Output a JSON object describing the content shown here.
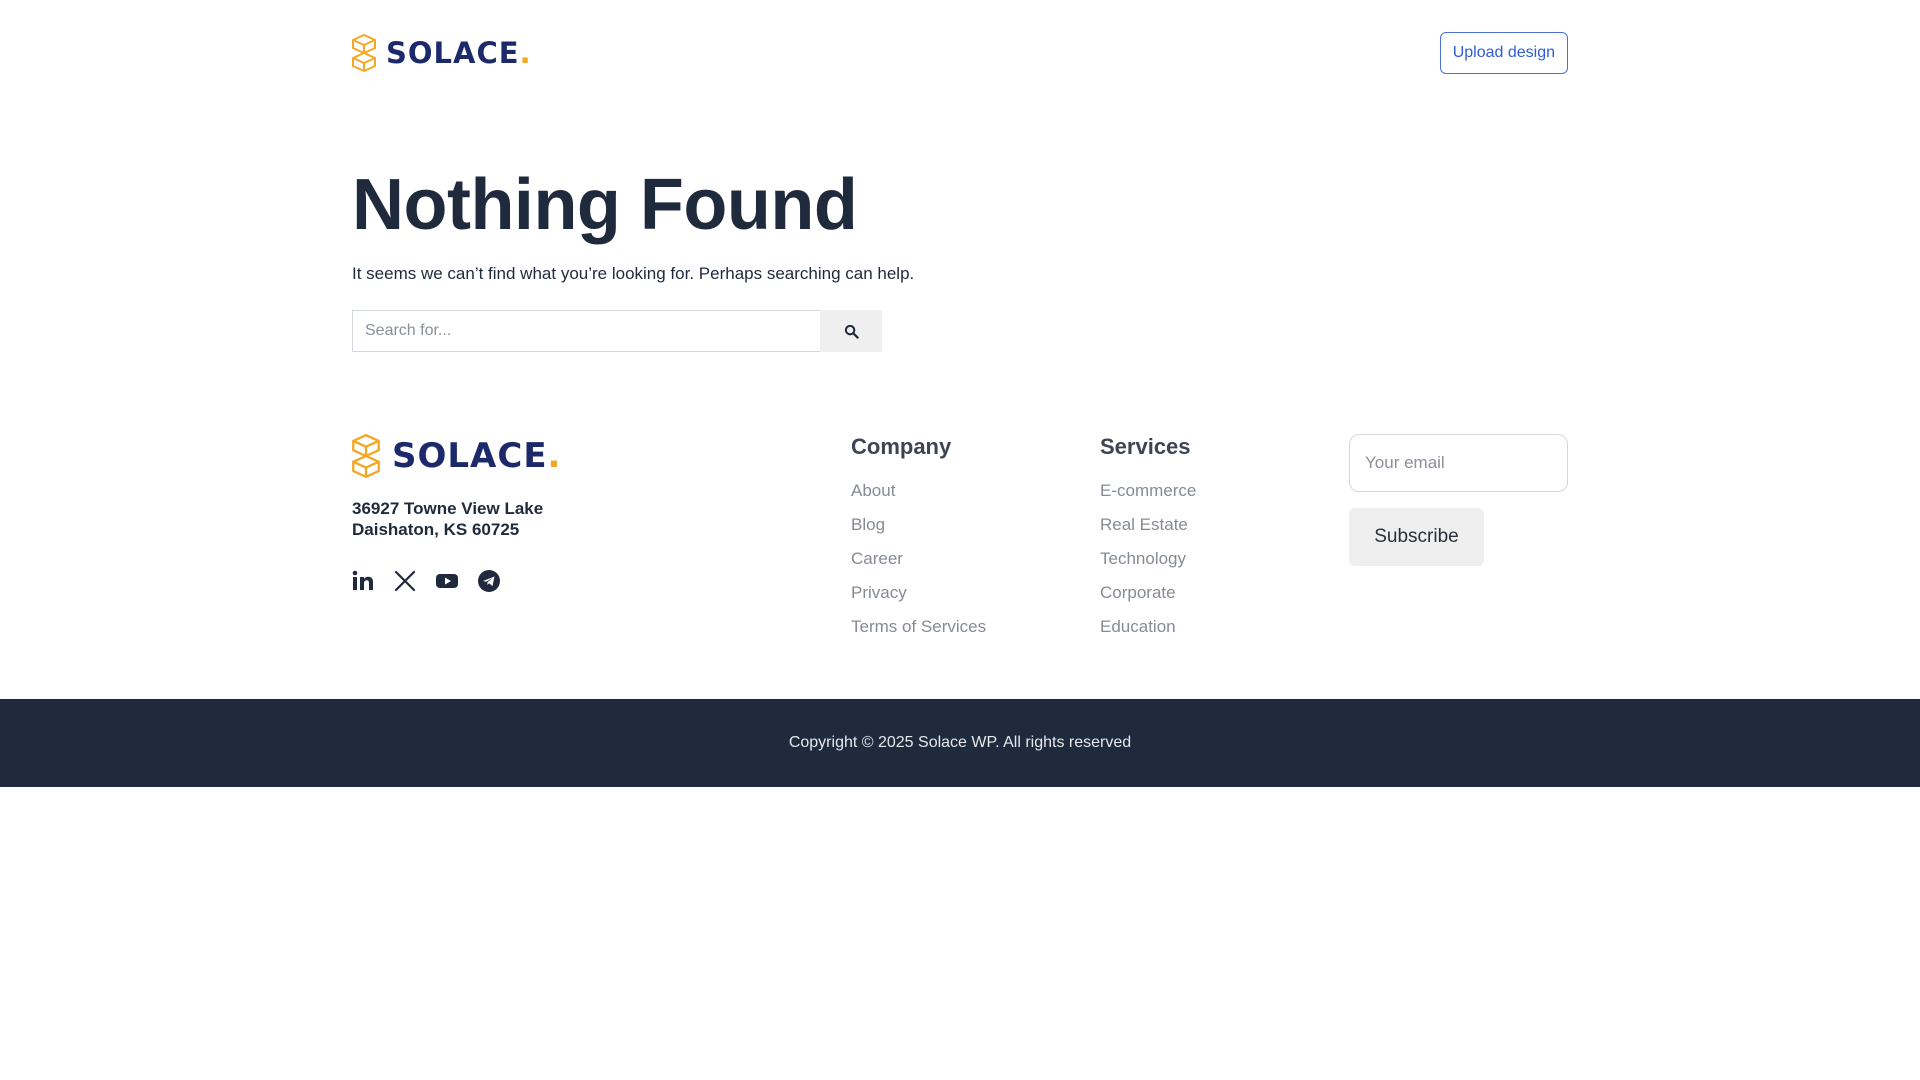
{
  "brand": {
    "name": "SOLACE",
    "dot": "."
  },
  "header": {
    "upload_label": "Upload design"
  },
  "main": {
    "title": "Nothing Found",
    "description": "It seems we can’t find what you’re looking for. Perhaps searching can help.",
    "search": {
      "placeholder": "Search for...",
      "button_icon": "search-icon"
    }
  },
  "footer": {
    "address_line1": "36927 Towne View Lake",
    "address_line2": "Daishaton, KS 60725",
    "social": [
      "linkedin-icon",
      "x-icon",
      "youtube-icon",
      "telegram-icon"
    ],
    "company": {
      "title": "Company",
      "items": [
        "About",
        "Blog",
        "Career",
        "Privacy",
        "Terms of Services"
      ]
    },
    "services": {
      "title": "Services",
      "items": [
        "E-commerce",
        "Real Estate",
        "Technology",
        "Corporate",
        "Education"
      ]
    },
    "newsletter": {
      "email_placeholder": "Your email",
      "subscribe_label": "Subscribe"
    }
  },
  "copyright": "Copyright © 2025 Solace WP. All rights reserved",
  "colors": {
    "brand_navy": "#1c2a6b",
    "brand_orange": "#f5a623",
    "footer_bar": "#1f2a3d",
    "link_blue": "#2f5bd9"
  }
}
